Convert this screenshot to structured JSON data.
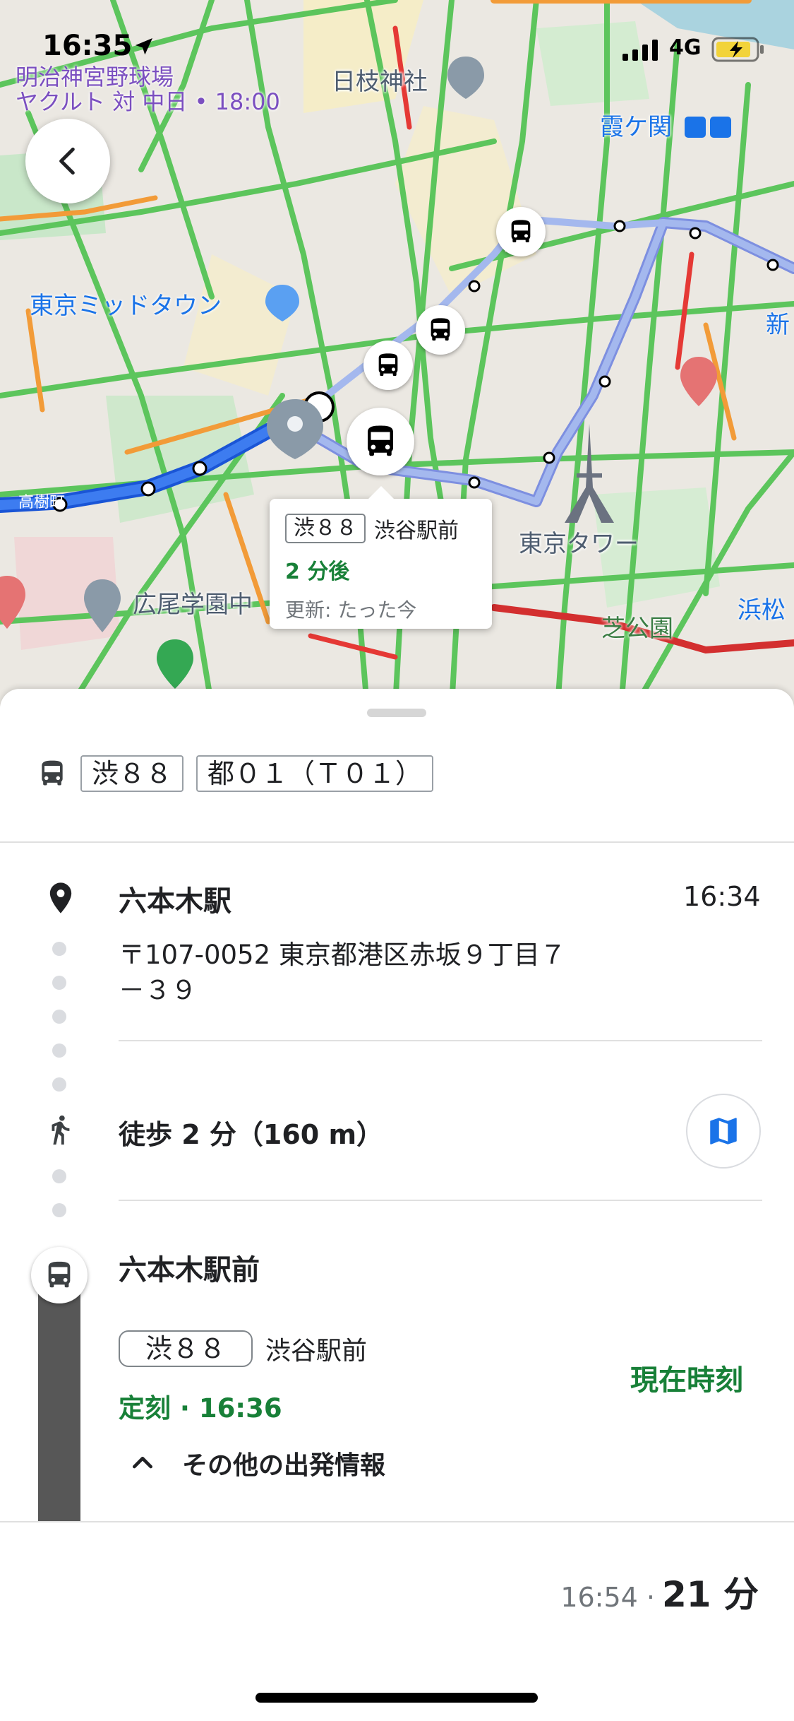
{
  "status": {
    "time": "16:35",
    "network": "4G"
  },
  "map": {
    "labels": {
      "stadium_line1": "明治神宮野球場",
      "stadium_line2": "ヤクルト 対 中日 • 18:00",
      "hie_shrine": "日枝神社",
      "kasumigaseki": "霞ケ関",
      "midtown": "東京ミッドタウン",
      "shin": "新",
      "tokyo_tower": "東京タワー",
      "hiroo": "広尾学園中",
      "shibakoen": "芝公園",
      "hamamatsu": "浜松",
      "takagi": "高樹町"
    },
    "bubble": {
      "route": "渋８８",
      "destination": "渋谷駅前",
      "eta": "2 分後",
      "updated": "更新: たった今"
    }
  },
  "sheet": {
    "routes": [
      "渋８８",
      "都０１（Ｔ０１）"
    ],
    "origin": {
      "name": "六本木駅",
      "time": "16:34",
      "address_line1": "〒107-0052 東京都港区赤坂９丁目７",
      "address_line2": "－３９"
    },
    "walk": {
      "label": "徒歩 2 分（160 m）"
    },
    "bus_stop": {
      "name": "六本木駅前",
      "route": "渋８８",
      "destination": "渋谷駅前",
      "schedule": "定刻 · 16:36",
      "realtime": "現在時刻",
      "more": "その他の出発情報"
    }
  },
  "footer": {
    "arrival": "16:54 ·",
    "duration": "21 分"
  }
}
